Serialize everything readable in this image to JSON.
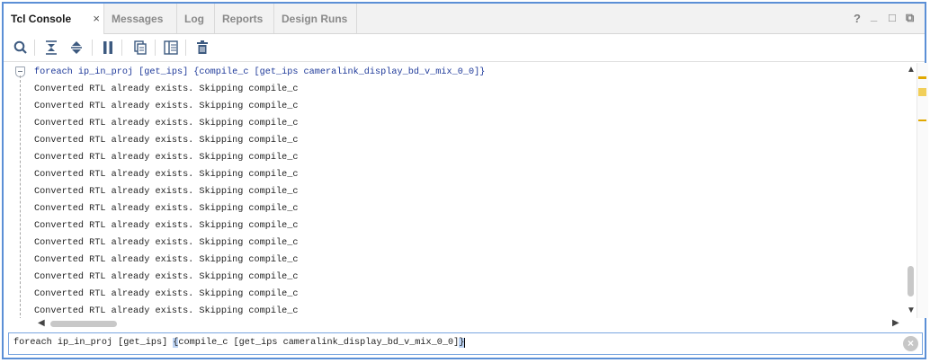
{
  "tabs": [
    {
      "label": "Tcl Console",
      "active": true,
      "closable": true,
      "close_glyph": "×"
    },
    {
      "label": "Messages"
    },
    {
      "label": "Log"
    },
    {
      "label": "Reports"
    },
    {
      "label": "Design Runs"
    }
  ],
  "window_controls": {
    "help": "?",
    "minimize": "_",
    "maximize": "□",
    "float": "⧉"
  },
  "toolbar": {
    "icons": [
      "search-icon",
      "collapse-all-icon",
      "expand-all-icon",
      "pause-icon",
      "copy-icon",
      "show-columns-icon",
      "delete-icon"
    ]
  },
  "console": {
    "command": "foreach ip_in_proj [get_ips] {compile_c [get_ips cameralink_display_bd_v_mix_0_0]}",
    "lines": [
      "Converted RTL already exists. Skipping compile_c",
      "Converted RTL already exists. Skipping compile_c",
      "Converted RTL already exists. Skipping compile_c",
      "Converted RTL already exists. Skipping compile_c",
      "Converted RTL already exists. Skipping compile_c",
      "Converted RTL already exists. Skipping compile_c",
      "Converted RTL already exists. Skipping compile_c",
      "Converted RTL already exists. Skipping compile_c",
      "Converted RTL already exists. Skipping compile_c",
      "Converted RTL already exists. Skipping compile_c",
      "Converted RTL already exists. Skipping compile_c",
      "Converted RTL already exists. Skipping compile_c",
      "Converted RTL already exists. Skipping compile_c",
      "Converted RTL already exists. Skipping compile_c"
    ]
  },
  "scroll": {
    "vertical_position": 0.85,
    "horizontal_position": 0.02
  },
  "input": {
    "part_before": "foreach ip_in_proj [get_ips] ",
    "highlight_open": "{",
    "part_middle": "compile_c [get_ips cameralink_display_bd_v_mix_0_0]",
    "highlight_close": "}",
    "clear_glyph": "×"
  },
  "colors": {
    "accent": "#5b8fd6",
    "warning_marker": "#e0a800",
    "command_text": "#1f3a9a"
  }
}
